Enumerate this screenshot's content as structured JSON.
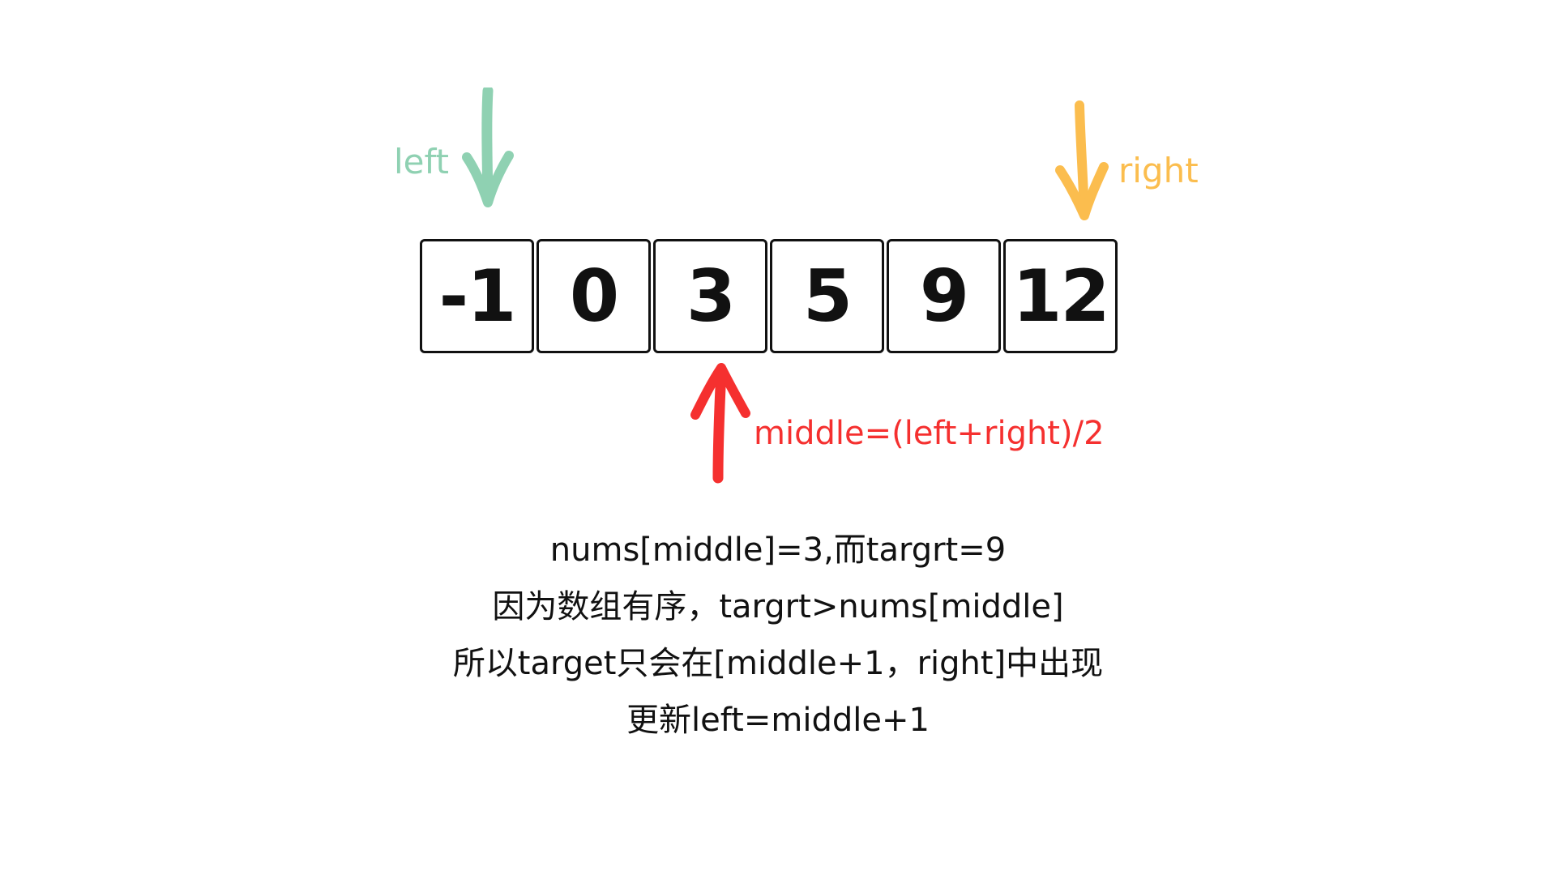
{
  "colors": {
    "left": "#8fd1b2",
    "right": "#fbbd4e",
    "middle": "#f5302f",
    "text": "#111111",
    "border": "#111111"
  },
  "pointers": {
    "left": {
      "label": "left",
      "icon": "down-arrow-icon"
    },
    "right": {
      "label": "right",
      "icon": "down-arrow-icon"
    },
    "middle": {
      "label": "middle=(left+right)/2",
      "icon": "up-arrow-icon"
    }
  },
  "array": {
    "values": [
      "-1",
      "0",
      "3",
      "5",
      "9",
      "12"
    ]
  },
  "explanation": {
    "lines": [
      "nums[middle]=3,而targrt=9",
      "因为数组有序，targrt>nums[middle]",
      "所以target只会在[middle+1，right]中出现",
      "更新left=middle+1"
    ]
  }
}
